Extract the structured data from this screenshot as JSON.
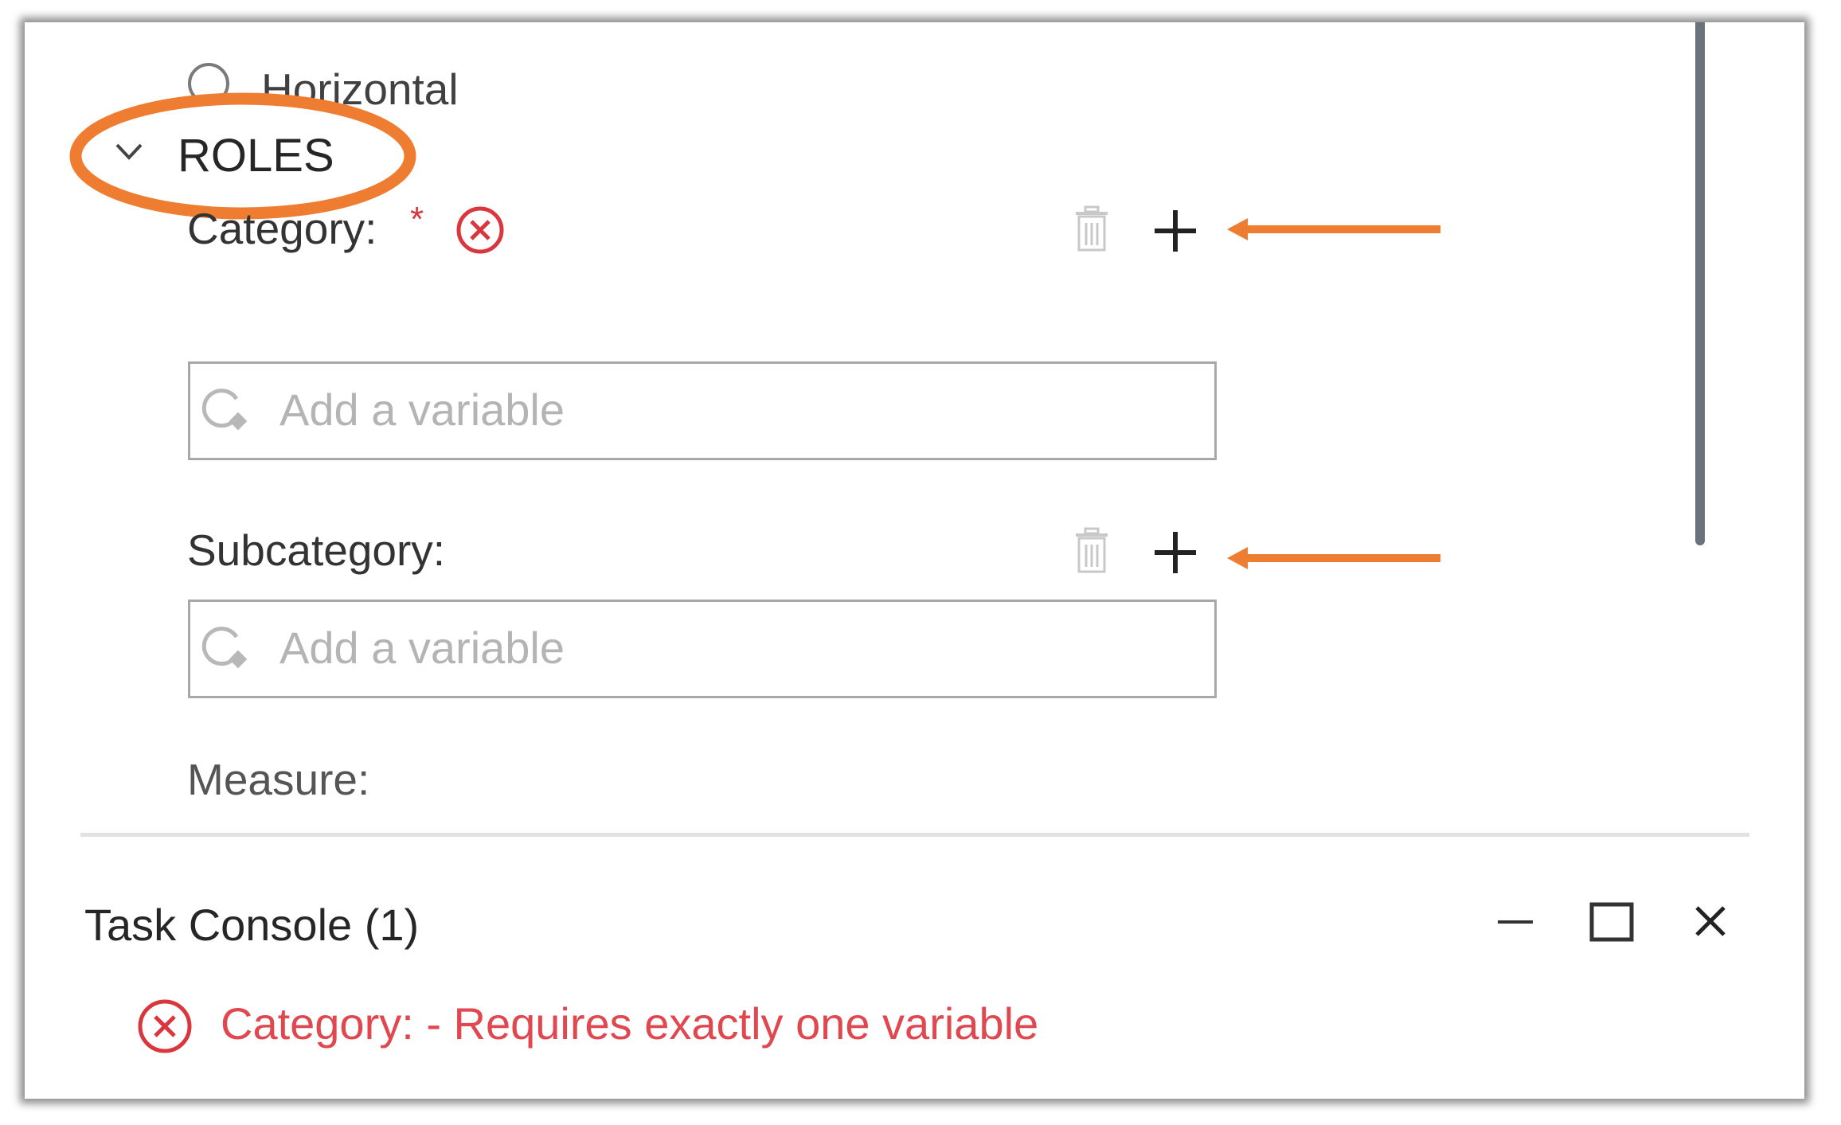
{
  "orientation": {
    "option_label": "Horizontal"
  },
  "roles": {
    "section_title": "ROLES"
  },
  "fields": {
    "category": {
      "label": "Category:",
      "required_marker": "*",
      "placeholder": "Add a variable"
    },
    "subcategory": {
      "label": "Subcategory:",
      "placeholder": "Add a variable"
    },
    "measure": {
      "label": "Measure:"
    }
  },
  "task_console": {
    "title": "Task Console (1)",
    "messages": [
      {
        "text": "Category: - Requires exactly one variable"
      }
    ]
  },
  "colors": {
    "annotation": "#ef7d31",
    "error": "#d9363e",
    "label": "#333333",
    "placeholder": "#b4b4b4"
  },
  "icons": {
    "error": "error-circle-x-icon",
    "delete": "trash-icon",
    "add": "plus-icon",
    "expand": "chevron-down-icon",
    "variable": "search-variable-icon"
  }
}
